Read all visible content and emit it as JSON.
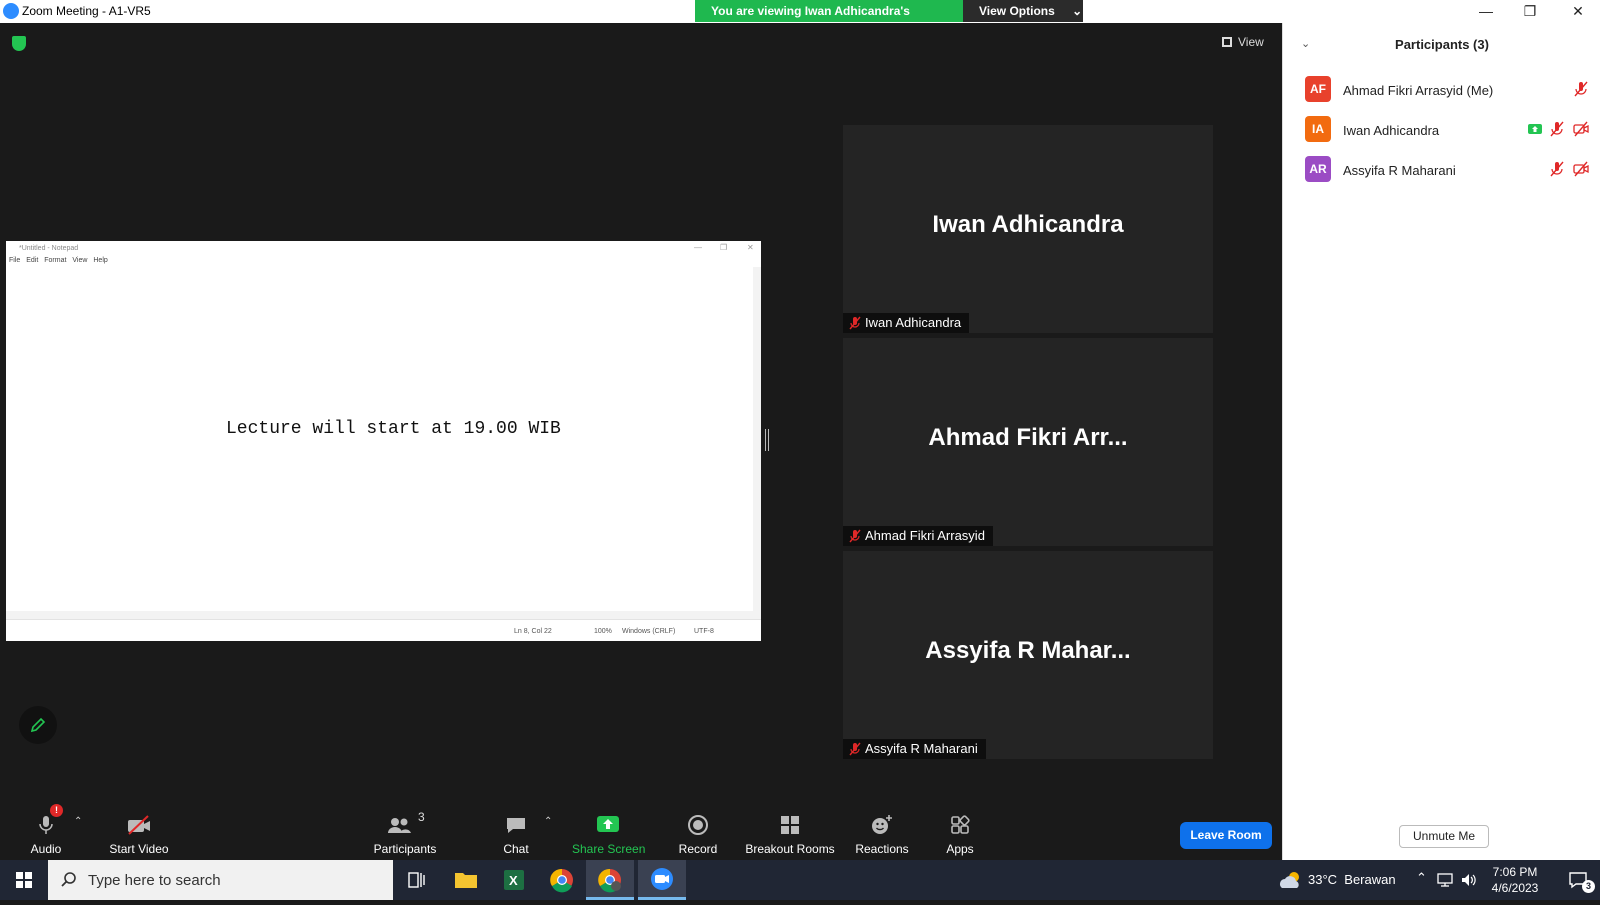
{
  "window": {
    "title": "Zoom Meeting - A1-VR5",
    "controls": {
      "minimize": "—",
      "restore": "❐",
      "close": "✕"
    }
  },
  "banner": {
    "message": "You are viewing Iwan Adhicandra's screen",
    "view_options": "View Options"
  },
  "view_button": "View",
  "shared_screen": {
    "title": "*Untitled - Notepad",
    "menu": [
      "File",
      "Edit",
      "Format",
      "View",
      "Help"
    ],
    "text": "Lecture will start at 19.00 WIB",
    "status": {
      "position": "Ln 8, Col 22",
      "zoom": "100%",
      "line_ending": "Windows (CRLF)",
      "encoding": "UTF-8"
    }
  },
  "video_tiles": [
    {
      "display": "Iwan Adhicandra",
      "name": "Iwan Adhicandra",
      "muted": true
    },
    {
      "display": "Ahmad Fikri Arr...",
      "name": "Ahmad Fikri Arrasyid",
      "muted": true
    },
    {
      "display": "Assyifa R Mahar...",
      "name": "Assyifa R Maharani",
      "muted": true
    }
  ],
  "toolbar": {
    "audio": "Audio",
    "audio_alert": "!",
    "start_video": "Start Video",
    "participants": "Participants",
    "participants_count": "3",
    "chat": "Chat",
    "share_screen": "Share Screen",
    "record": "Record",
    "breakout_rooms": "Breakout Rooms",
    "reactions": "Reactions",
    "apps": "Apps",
    "leave": "Leave Room"
  },
  "participants_panel": {
    "header": "Participants (3)",
    "list": [
      {
        "initials": "AF",
        "name": "Ahmad Fikri Arrasyid (Me)",
        "color": "#e8412c"
      },
      {
        "initials": "IA",
        "name": "Iwan Adhicandra",
        "color": "#f26b10"
      },
      {
        "initials": "AR",
        "name": "Assyifa R Maharani",
        "color": "#9b4cc4"
      }
    ],
    "unmute_button": "Unmute Me"
  },
  "taskbar": {
    "search_placeholder": "Type here to search",
    "weather": "33°C  Berawan",
    "time": "7:06 PM",
    "date": "4/6/2023",
    "notifications": "3"
  },
  "colors": {
    "zoom_blue": "#0e71eb",
    "share_green": "#23c552",
    "muted_red": "#e02828"
  }
}
